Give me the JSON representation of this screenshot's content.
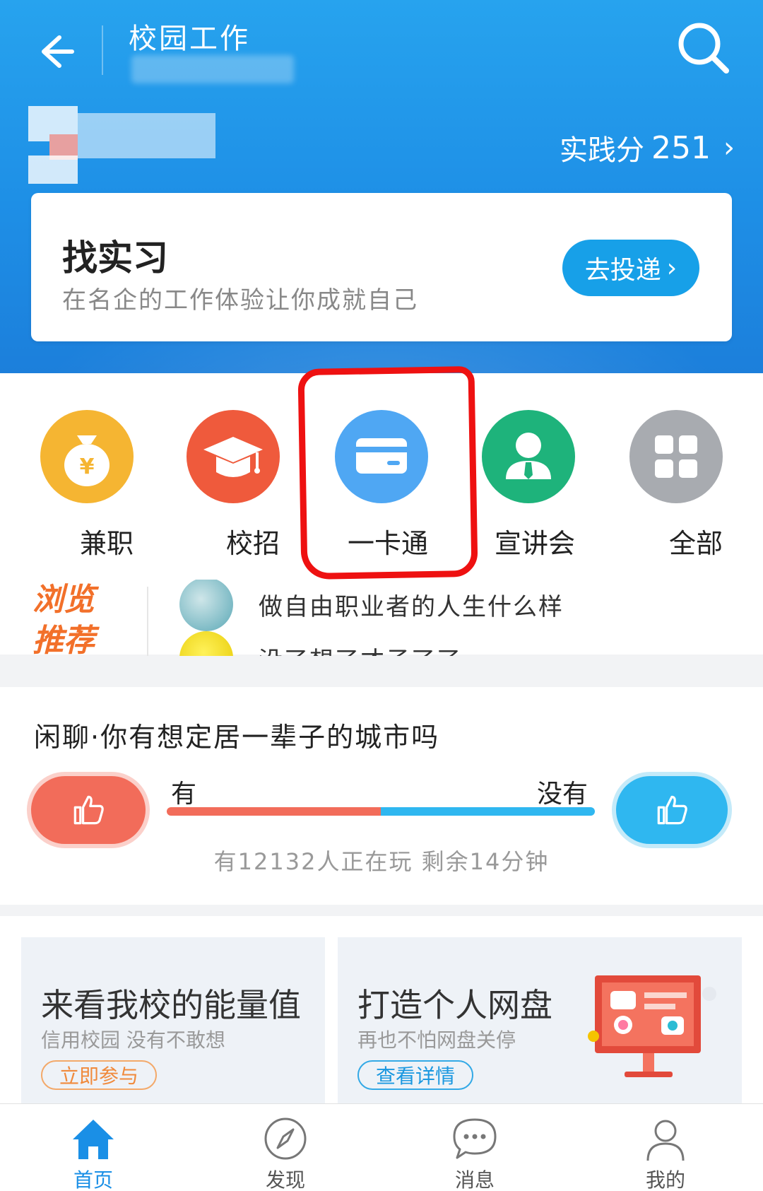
{
  "header": {
    "title": "校园工作",
    "score_label": "实践分",
    "score_value": "251"
  },
  "intern_card": {
    "title": "找实习",
    "subtitle": "在名企的工作体验让你成就自己",
    "button": "去投递"
  },
  "quick_links": [
    {
      "label": "兼职",
      "icon": "money-bag-icon",
      "color": "#f5b532"
    },
    {
      "label": "校招",
      "icon": "graduation-cap-icon",
      "color": "#ef5a3c"
    },
    {
      "label": "一卡通",
      "icon": "card-icon",
      "color": "#4fa7f3"
    },
    {
      "label": "宣讲会",
      "icon": "person-icon",
      "color": "#1eb37b"
    },
    {
      "label": "全部",
      "icon": "grid-icon",
      "color": "#a8abb0"
    }
  ],
  "recommend": {
    "label": "浏览推荐",
    "items": [
      "做自由职业者的人生什么样",
      "没了想了才子了了"
    ]
  },
  "poll": {
    "question": "闲聊·你有想定居一辈子的城市吗",
    "option_yes": "有",
    "option_no": "没有",
    "yes_share": 0.5,
    "stat": "有12132人正在玩 剩余14分钟"
  },
  "promos": [
    {
      "title": "来看我校的能量值",
      "subtitle": "信用校园 没有不敢想",
      "button": "立即参与"
    },
    {
      "title": "打造个人网盘",
      "subtitle": "再也不怕网盘关停",
      "button": "查看详情"
    }
  ],
  "tabs": [
    {
      "label": "首页",
      "icon": "home-icon",
      "active": true
    },
    {
      "label": "发现",
      "icon": "compass-icon",
      "active": false
    },
    {
      "label": "消息",
      "icon": "message-icon",
      "active": false
    },
    {
      "label": "我的",
      "icon": "user-icon",
      "active": false
    }
  ],
  "colors": {
    "brand_blue": "#1e8fe6",
    "accent_orange": "#f2702a",
    "annotation_red": "#ee1111"
  }
}
